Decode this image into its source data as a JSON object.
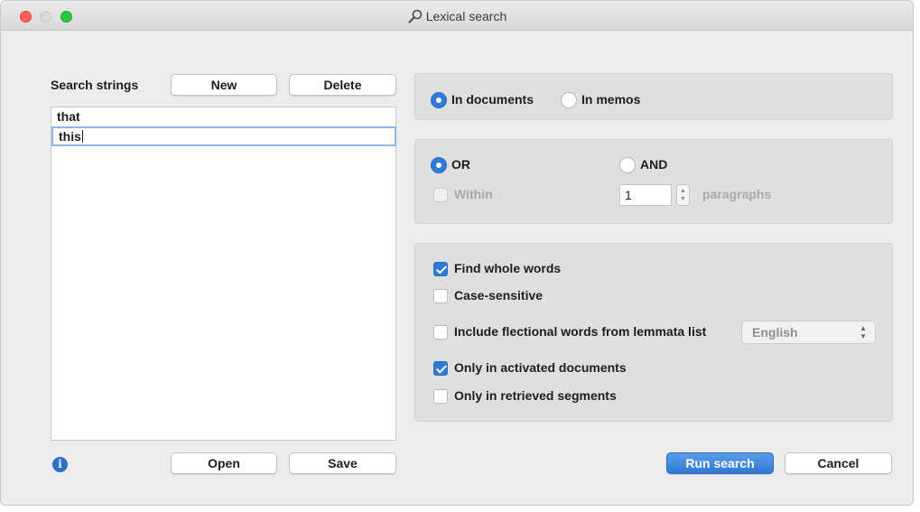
{
  "window": {
    "title": "Lexical search"
  },
  "search_strings": {
    "label": "Search strings",
    "new_label": "New",
    "delete_label": "Delete",
    "items": [
      "that",
      "this"
    ],
    "open_label": "Open",
    "save_label": "Save",
    "info_glyph": "i"
  },
  "scope": {
    "in_documents": "In documents",
    "in_memos": "In memos",
    "selected": "In documents"
  },
  "logic": {
    "or": "OR",
    "and": "AND",
    "selected": "OR",
    "within": "Within",
    "within_value": "1",
    "paragraphs": "paragraphs"
  },
  "options": {
    "find_whole_words": "Find whole words",
    "case_sensitive": "Case-sensitive",
    "include_flectional": "Include flectional words from lemmata list",
    "lemmata_language": "English",
    "only_activated": "Only in activated documents",
    "only_retrieved": "Only in retrieved segments",
    "checked": {
      "find_whole_words": true,
      "case_sensitive": false,
      "include_flectional": false,
      "only_activated": true,
      "only_retrieved": false
    }
  },
  "actions": {
    "run_label": "Run search",
    "cancel_label": "Cancel"
  },
  "colors": {
    "accent": "#2f7ad8",
    "close": "#ff5f57",
    "maximize": "#28c840",
    "info": "#2d6ec9"
  },
  "icons": {
    "title": "magnifier-icon",
    "info": "info-icon"
  }
}
